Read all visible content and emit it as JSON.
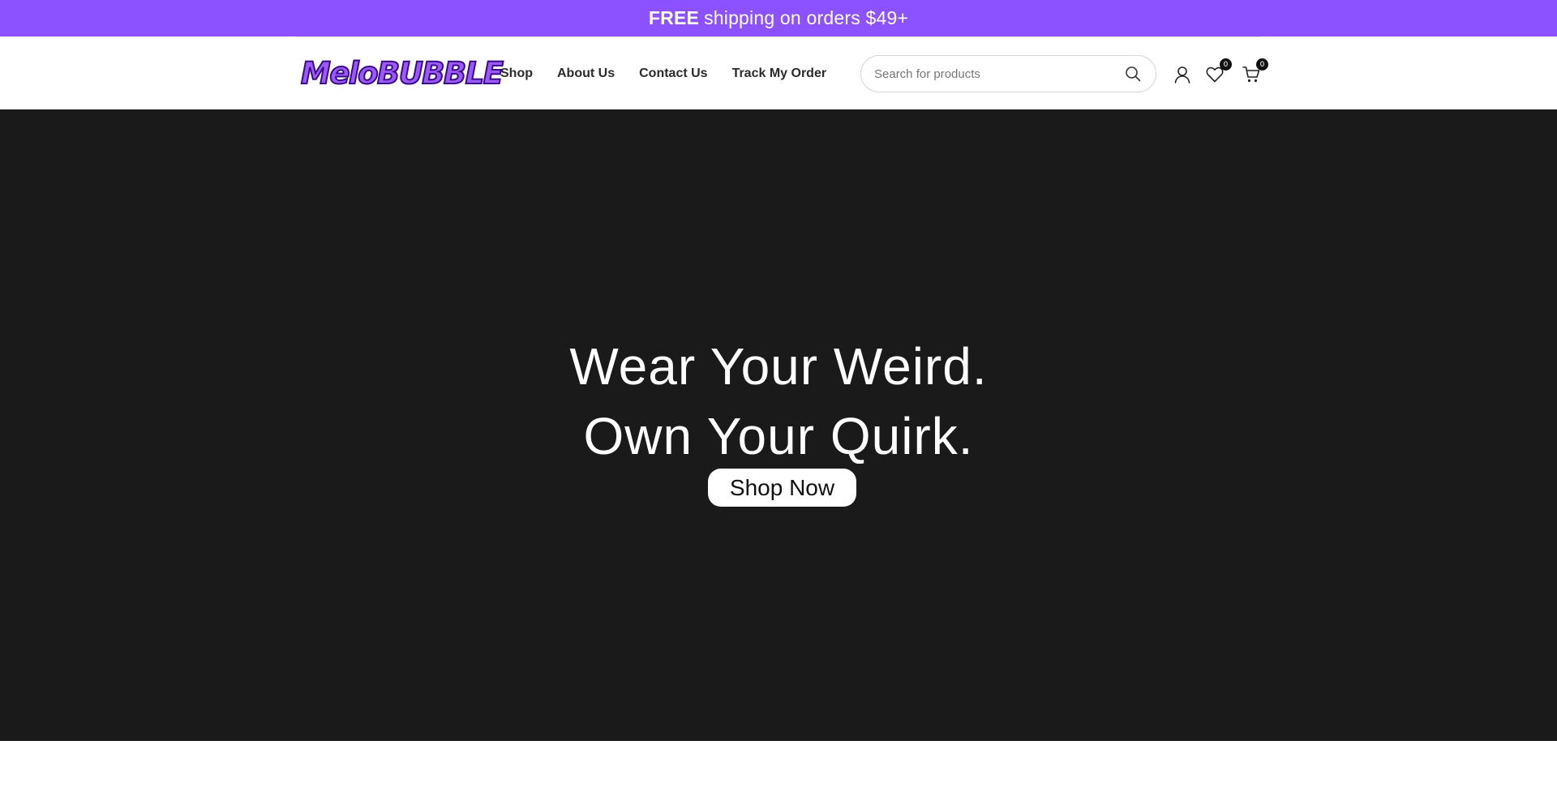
{
  "announcement": {
    "strong_text": "FREE",
    "text": "shipping on orders $49+",
    "background_color": "#8c52ff"
  },
  "header": {
    "logo_text": "MeloBUBBLE",
    "nav": [
      {
        "label": "Shop"
      },
      {
        "label": "About Us"
      },
      {
        "label": "Contact Us"
      },
      {
        "label": "Track My Order"
      }
    ],
    "search": {
      "placeholder": "Search for products",
      "value": "",
      "icon": "search-icon"
    },
    "icons": {
      "account": "user-icon",
      "wishlist": "heart-icon",
      "cart": "cart-icon"
    },
    "wishlist_count": "0",
    "cart_count": "0"
  },
  "hero": {
    "line1": "Wear Your Weird.",
    "line2": "Own Your Quirk.",
    "cta_label": "Shop Now",
    "background_color": "#1a1a1a"
  }
}
